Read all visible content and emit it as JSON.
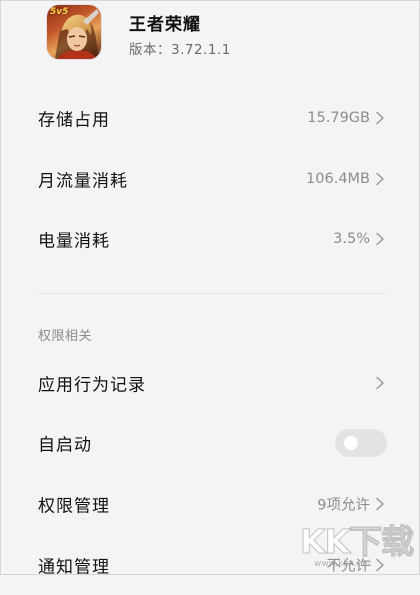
{
  "app": {
    "name": "王者荣耀",
    "version_label": "版本：",
    "version": "3.72.1.1",
    "icon_badge": "5v5"
  },
  "rows": {
    "storage": {
      "label": "存储占用",
      "value": "15.79GB"
    },
    "data": {
      "label": "月流量消耗",
      "value": "106.4MB"
    },
    "battery": {
      "label": "电量消耗",
      "value": "3.5%"
    },
    "behavior": {
      "label": "应用行为记录"
    },
    "autostart": {
      "label": "自启动",
      "enabled": false
    },
    "permissions": {
      "label": "权限管理",
      "value": "9项允许"
    },
    "notifications": {
      "label": "通知管理",
      "value": "不允许"
    }
  },
  "sections": {
    "permissions_title": "权限相关"
  },
  "watermark": {
    "text": "KK下载",
    "url": "www.kkx.net"
  },
  "colors": {
    "background": "#f4f4f4",
    "primary_text": "#111111",
    "secondary_text": "#8c8c8c",
    "toggle_off": "#e3e3e3"
  }
}
